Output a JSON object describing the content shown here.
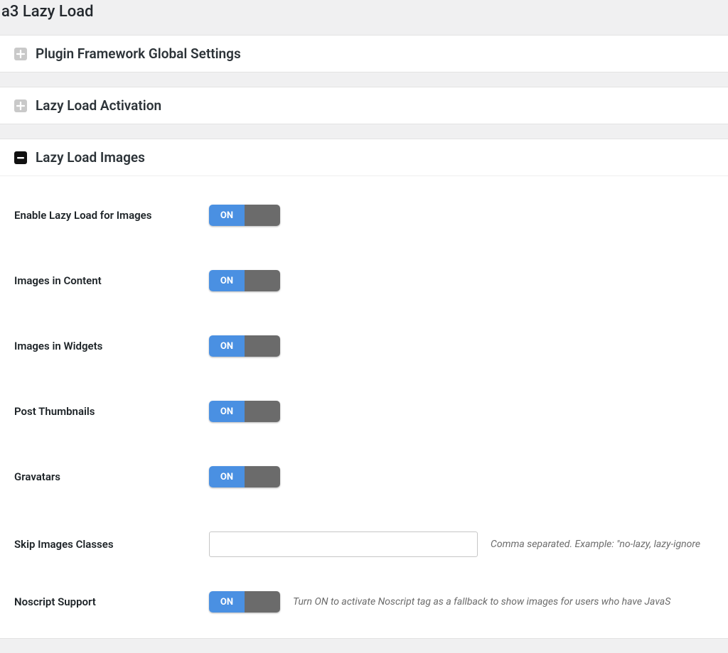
{
  "page_title": "a3 Lazy Load",
  "panels": {
    "framework": {
      "title": "Plugin Framework Global Settings"
    },
    "activation": {
      "title": "Lazy Load Activation"
    },
    "images": {
      "title": "Lazy Load Images",
      "rows": {
        "enable": {
          "label": "Enable Lazy Load for Images",
          "toggle_on": "ON"
        },
        "content": {
          "label": "Images in Content",
          "toggle_on": "ON"
        },
        "widgets": {
          "label": "Images in Widgets",
          "toggle_on": "ON"
        },
        "thumbnails": {
          "label": "Post Thumbnails",
          "toggle_on": "ON"
        },
        "gravatars": {
          "label": "Gravatars",
          "toggle_on": "ON"
        },
        "skip": {
          "label": "Skip Images Classes",
          "value": "",
          "help": "Comma separated. Example: \"no-lazy, lazy-ignore"
        },
        "noscript": {
          "label": "Noscript Support",
          "toggle_on": "ON",
          "help": "Turn ON to activate Noscript tag as a fallback to show images for users who have JavaS"
        }
      }
    }
  }
}
